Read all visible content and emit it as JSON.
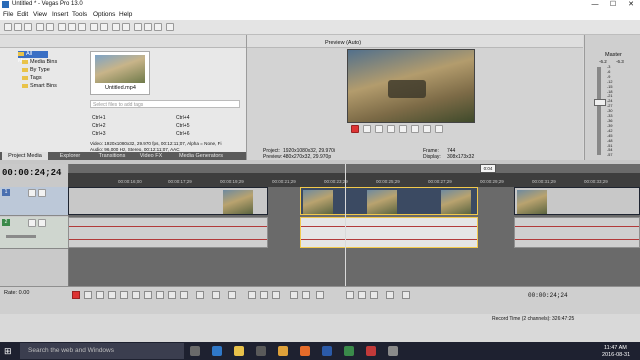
{
  "window": {
    "title": "Untitled * - Vegas Pro 13.0",
    "min": "—",
    "max": "☐",
    "close": "✕"
  },
  "menu": [
    "File",
    "Edit",
    "View",
    "Insert",
    "Tools",
    "Options",
    "Help"
  ],
  "media": {
    "tree": [
      "All Media",
      "Media Bins",
      "By Type",
      "Tags",
      "Smart Bins"
    ],
    "file_name": "Untitled.mp4",
    "search_placeholder": "Select files to add tags",
    "shortcuts": [
      "Ctrl+1",
      "Ctrl+2",
      "Ctrl+3",
      "Ctrl+4",
      "Ctrl+5",
      "Ctrl+6"
    ],
    "info1": "Video: 1920x1080x32, 29.970 fps, 00:12:11;07, Alpha = None, Fi",
    "info2": "Audio: 96,000 Hz, Stereo, 00:12:11;07, AAC"
  },
  "tabs": [
    "Project Media",
    "Explorer",
    "Transitions",
    "Video FX",
    "Media Generators"
  ],
  "preview": {
    "mode": "Preview (Auto)",
    "project_label": "Project:",
    "project_value": "1920x1080x32, 29.970i",
    "preview_label": "Preview:",
    "preview_value": "480x270x32, 29.970p",
    "frame_label": "Frame:",
    "frame_value": "744",
    "display_label": "Display:",
    "display_value": "308x173x32"
  },
  "master": {
    "label": "Master",
    "db": [
      "-6.2",
      "-6.3"
    ],
    "meters": [
      "-3",
      "-6",
      "-9",
      "-12",
      "-15",
      "-18",
      "-21",
      "-24",
      "-27",
      "-30",
      "-33",
      "-36",
      "-39",
      "-42",
      "-45",
      "-48",
      "-51",
      "-54",
      "-57"
    ]
  },
  "timeline": {
    "timecode": "00:00:24;24",
    "ruler": [
      "00:00:16;00",
      "00:00:17;29",
      "00:00:19;29",
      "00:00:21;29",
      "00:00:23;29",
      "00:00:25;29",
      "00:00:27;29",
      "00:00:29;29",
      "00:00:31;29",
      "00:00:33;29"
    ],
    "marker": "0:04",
    "track_numbers": [
      "1",
      "2"
    ]
  },
  "transport": {
    "rate_label": "Rate: 0.00",
    "end_time": "00:00:24;24",
    "record_time": "Record Time (2 channels): 326:47:25"
  },
  "taskbar": {
    "search": "Search the web and Windows",
    "time": "11:47 AM",
    "date": "2016-08-31"
  },
  "colors": {
    "accent": "#2a6bb8",
    "timeline_bg": "#6a6a6a",
    "selection": "#f2c94c",
    "waveform": "#b23a3a"
  }
}
